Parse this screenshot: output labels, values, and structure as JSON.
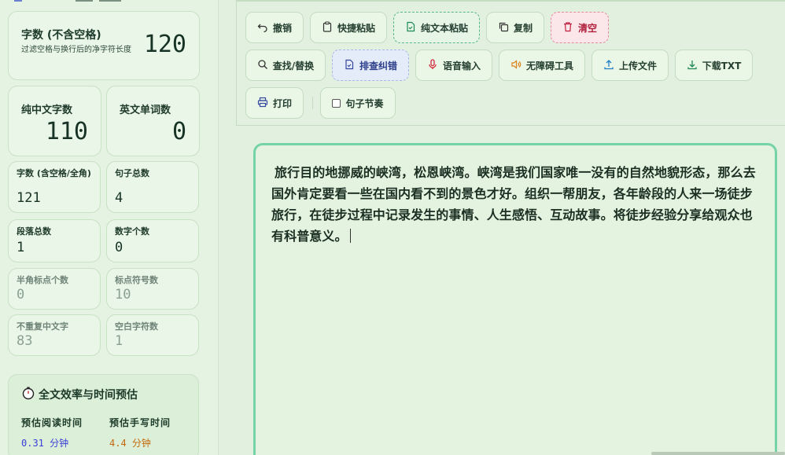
{
  "stats": {
    "main": {
      "title": "字数 (不含空格)",
      "subtitle": "过滤空格与换行后的净字符长度",
      "value": "120"
    },
    "chinese": {
      "label": "纯中文字数",
      "value": "110"
    },
    "english": {
      "label": "英文单词数",
      "value": "0"
    },
    "with_spaces": {
      "label": "字数 (含空格/全角)",
      "value": "121"
    },
    "sentences": {
      "label": "句子总数",
      "value": "4"
    },
    "paragraphs": {
      "label": "段落总数",
      "value": "1"
    },
    "digits": {
      "label": "数字个数",
      "value": "0"
    },
    "half_punct": {
      "label": "半角标点个数",
      "value": "0"
    },
    "punct": {
      "label": "标点符号数",
      "value": "10"
    },
    "unique_cn": {
      "label": "不重复中文字",
      "value": "83"
    },
    "blank": {
      "label": "空白字符数",
      "value": "1"
    }
  },
  "efficiency": {
    "title": "全文效率与时间预估",
    "read_label": "预估阅读时间",
    "read_value": "0.31 分钟",
    "write_label": "预估手写时间",
    "write_value": "4.4 分钟",
    "read_color": "#3b3fd8",
    "write_color": "#c26a0e"
  },
  "toolbar": {
    "undo": "撤销",
    "quick_paste": "快捷粘贴",
    "plain_paste": "纯文本粘贴",
    "copy": "复制",
    "clear": "清空",
    "find_replace": "查找/替换",
    "typo_check": "排查纠错",
    "voice_input": "语音输入",
    "accessibility": "无障碍工具",
    "upload": "上传文件",
    "download": "下载TXT",
    "print": "打印",
    "rhythm": "句子节奏"
  },
  "editor": {
    "content": "旅行目的地挪威的峡湾，松恩峡湾。峡湾是我们国家唯一没有的自然地貌形态，那么去国外肯定要看一些在国内看不到的景色才好。组织一帮朋友，各年龄段的人来一场徒步旅行，在徒步过程中记录发生的事情、人生感悟、互动故事。将徒步经验分享给观众也有科普意义。"
  },
  "icons": [
    "undo-icon",
    "clipboard-icon",
    "file-text-icon",
    "copy-icon",
    "trash-icon",
    "search-icon",
    "spell-check-icon",
    "mic-icon",
    "volume-icon",
    "upload-icon",
    "download-icon",
    "printer-icon",
    "stopwatch-icon"
  ]
}
